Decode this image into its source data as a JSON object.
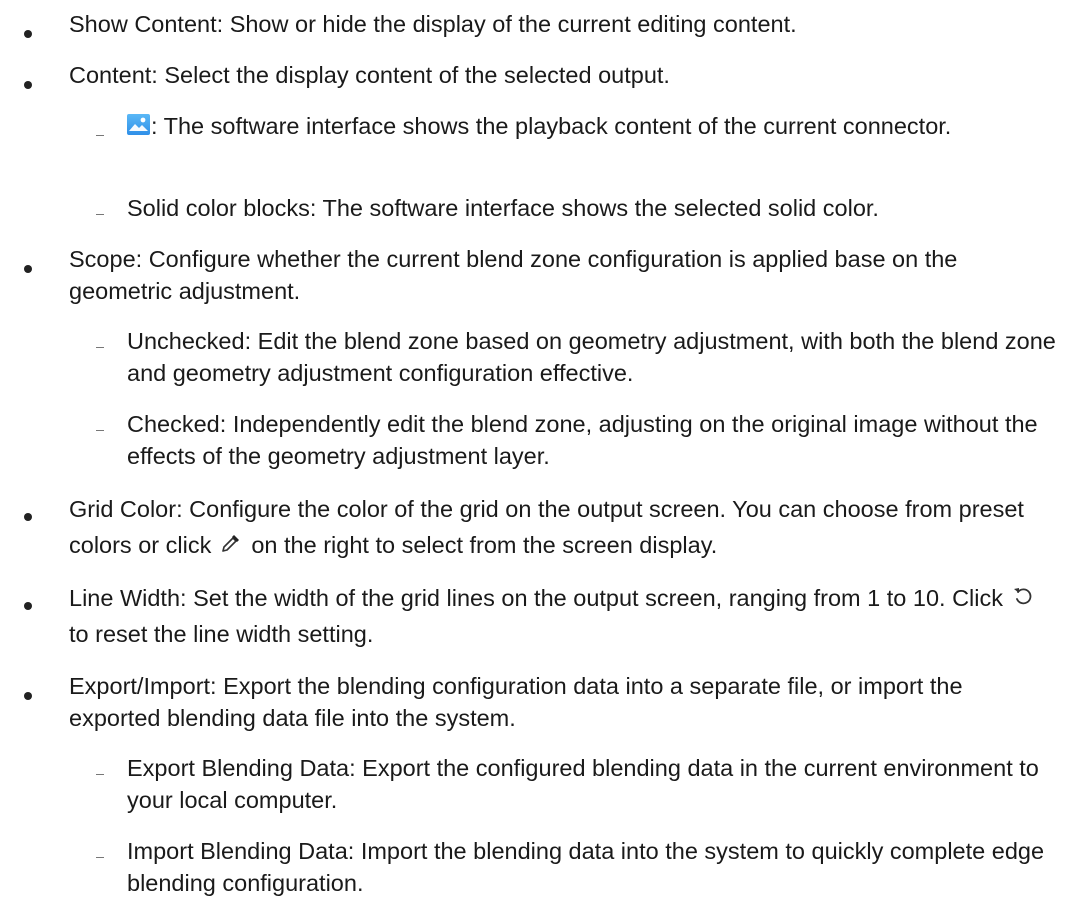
{
  "items": [
    {
      "label": "Show Content:",
      "text": "Show or hide the display of the current editing content."
    },
    {
      "label": "Content:",
      "text": "Select the display content of the selected output."
    },
    {
      "icon": "image-icon",
      "text": ": The software interface shows the playback content of the current connector."
    },
    {
      "label": "Solid color blocks:",
      "text": "The software interface shows the selected solid color."
    },
    {
      "label": "Scope:",
      "text": "Configure whether the current blend zone configuration is applied base on the geometric adjustment."
    },
    {
      "label": "Unchecked:",
      "text": "Edit the blend zone based on geometry adjustment, with both the blend zone and geometry adjustment configuration effective."
    },
    {
      "label": "Checked:",
      "text": "Independently edit the blend zone, adjusting on the original image without the effects of the geometry adjustment layer."
    },
    {
      "label": "Grid Color:",
      "text_before": "Configure the color of the grid on the output screen. You can choose from preset colors or click",
      "icon": "eyedropper-icon",
      "text_after": "on the right to select from the screen display."
    },
    {
      "label": "Line Width:",
      "text_before": "Set the width of the grid lines on the output screen, ranging from 1 to 10. Click",
      "icon": "reset-icon",
      "text_after": "to reset the line width setting."
    },
    {
      "label": "Export/Import:",
      "text": "Export the blending configuration data into a separate file, or import the exported blending data file into the system."
    },
    {
      "label": "Export Blending Data:",
      "text": "Export the configured blending data in the current environment to your local computer."
    },
    {
      "label": "Import Blending Data:",
      "text": "Import the blending data into the system to quickly complete edge blending configuration."
    }
  ]
}
